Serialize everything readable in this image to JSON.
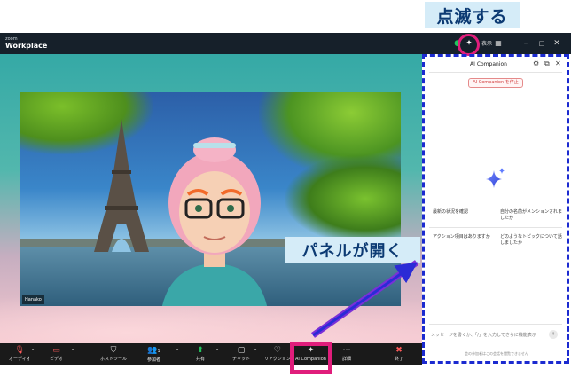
{
  "annotations": {
    "top_callout": "点滅する",
    "mid_callout": "パネルが開く"
  },
  "titlebar": {
    "brand_small": "zoom",
    "brand_big": "Workplace",
    "view_label": "表示",
    "icons": [
      "shield-icon",
      "sparkle-icon",
      "grid-icon",
      "minimize-icon",
      "maximize-icon",
      "close-icon"
    ]
  },
  "video": {
    "participant_name": "Hanako"
  },
  "toolbar": {
    "items": [
      {
        "label": "オーディオ",
        "icon": "mic-muted-icon"
      },
      {
        "label": "ビデオ",
        "icon": "video-off-icon"
      },
      {
        "label": "ホストツール",
        "icon": "shield-icon"
      },
      {
        "label": "参加者",
        "icon": "participants-icon",
        "count": "1"
      },
      {
        "label": "共有",
        "icon": "share-icon"
      },
      {
        "label": "チャット",
        "icon": "chat-icon"
      },
      {
        "label": "リアクション",
        "icon": "reaction-icon"
      },
      {
        "label": "AI Companion",
        "icon": "sparkle-icon"
      },
      {
        "label": "詳細",
        "icon": "more-icon"
      },
      {
        "label": "終了",
        "icon": "end-icon"
      }
    ]
  },
  "panel": {
    "title": "AI Companion",
    "stop_button": "AI Companion を停止",
    "suggestions": [
      "最新の状況を確認",
      "自分の名前がメンションされましたか",
      "アクション項目はありますか",
      "どのようなトピックについて話しましたか"
    ],
    "input_placeholder": "メッセージを書くか、「/」を入力してさらに機能表示",
    "footnote": "会の参加者はこの会話を閲覧できません",
    "send_label": "↑"
  },
  "colors": {
    "callout_bg": "#d5ecf8",
    "callout_text": "#0c3a73",
    "highlight_pink": "#e01d7b",
    "dashed_blue": "#1b2ad0"
  }
}
